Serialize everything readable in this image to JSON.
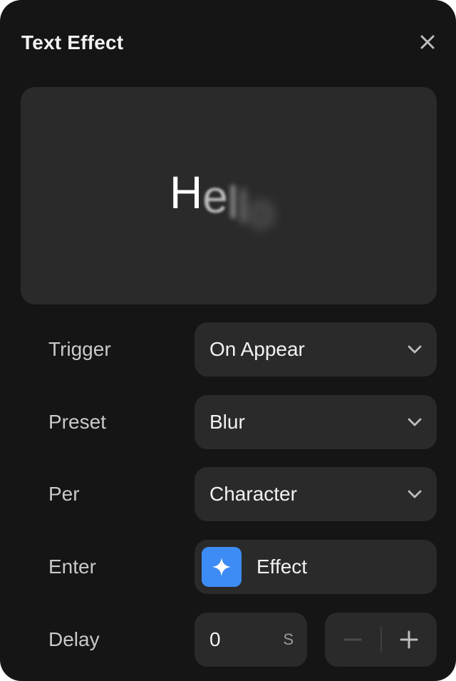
{
  "dialog": {
    "title": "Text Effect"
  },
  "preview": {
    "chars": [
      "H",
      "e",
      "l",
      "l",
      "o"
    ]
  },
  "rows": {
    "trigger": {
      "label": "Trigger",
      "value": "On Appear"
    },
    "preset": {
      "label": "Preset",
      "value": "Blur"
    },
    "per": {
      "label": "Per",
      "value": "Character"
    },
    "enter": {
      "label": "Enter",
      "value": "Effect"
    },
    "delay": {
      "label": "Delay",
      "value": "0",
      "unit": "S"
    }
  },
  "icons": {
    "close": "close-icon",
    "chevron": "chevron-down-icon",
    "effect": "sparkle-icon",
    "minus": "minus-icon",
    "plus": "plus-icon"
  },
  "colors": {
    "panel_bg": "#151515",
    "control_bg": "#2a2a2a",
    "accent": "#3d8cf5",
    "text_primary": "#f2f2f2",
    "text_secondary": "#c9c9c9"
  }
}
